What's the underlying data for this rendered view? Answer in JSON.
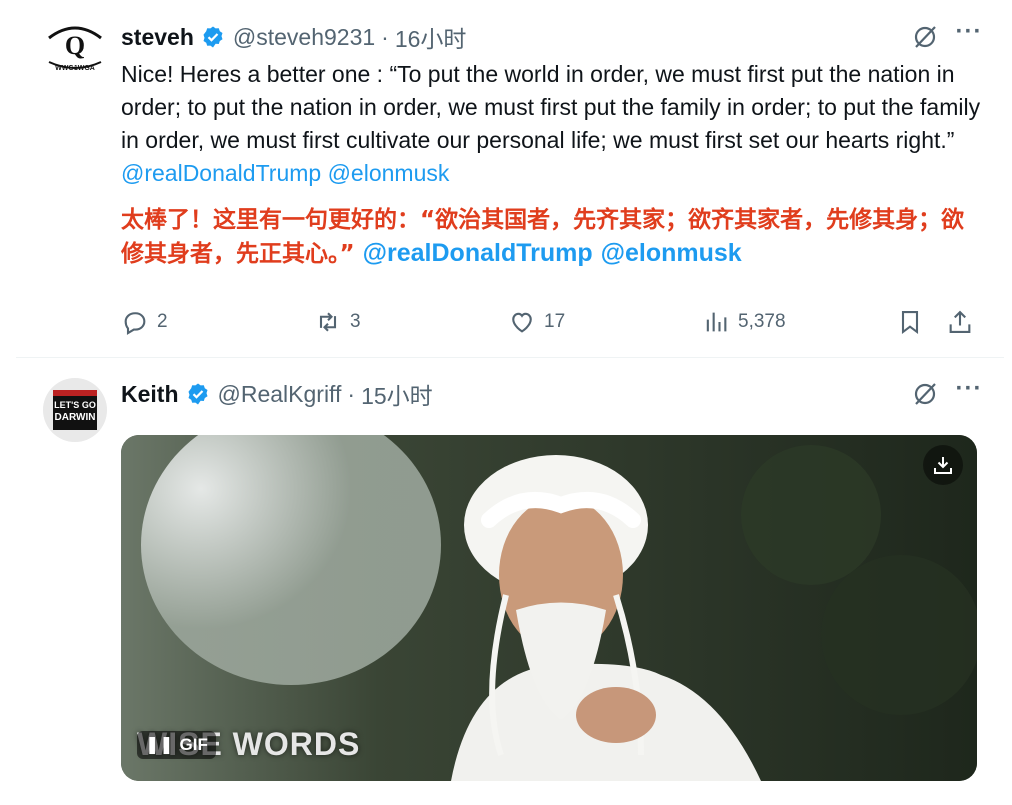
{
  "tweet1": {
    "name": "steveh",
    "handle": "@steveh9231",
    "separator": "·",
    "time": "16小时",
    "text_en_1": "Nice! Heres a better one : “To put the world in order, we must first put the nation in order; to put the nation in order, we must first put the family in order; to put the family in order, we must first cultivate our personal life; we must first set our hearts right.”",
    "mention_1": "@realDonaldTrump",
    "mention_2": "@elonmusk",
    "text_zh": "太棒了！这里有一句更好的：“欲治其国者，先齐其家；欲齐其家者，先修其身；欲修其身者，先正其心。”",
    "zh_mention_1": "@realDonaldTrump",
    "zh_mention_2": "@elonmusk",
    "replies": "2",
    "retweets": "3",
    "likes": "17",
    "views": "5,378",
    "avatar_text_top": "Q",
    "avatar_text_bottom": "WWG1WGA"
  },
  "tweet2": {
    "name": "Keith",
    "handle": "@RealKgriff",
    "separator": "·",
    "time": "15小时",
    "avatar_line1": "LET'S GO",
    "avatar_line2": "DARWIN",
    "gif_label": "GIF",
    "gif_caption": "WISE WORDS"
  },
  "colors": {
    "accent": "#1d9bf0",
    "secondary_text": "#536471",
    "highlight_red": "#e03d1d"
  }
}
